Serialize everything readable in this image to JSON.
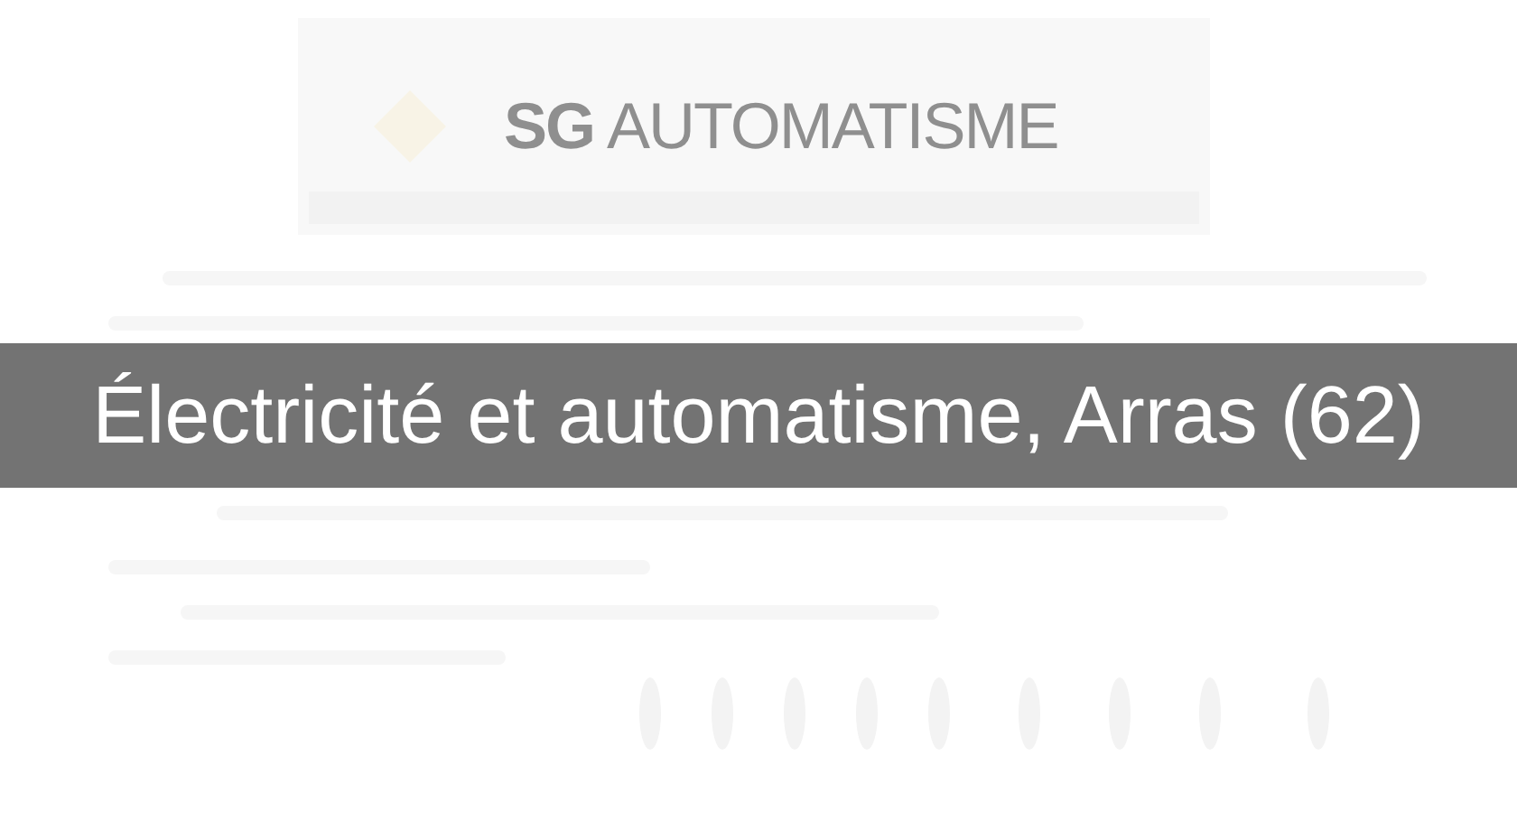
{
  "header": {
    "logo_bold": "SG",
    "logo_rest": "AUTOMATISME"
  },
  "title": "Électricité et automatisme, Arras (62)"
}
